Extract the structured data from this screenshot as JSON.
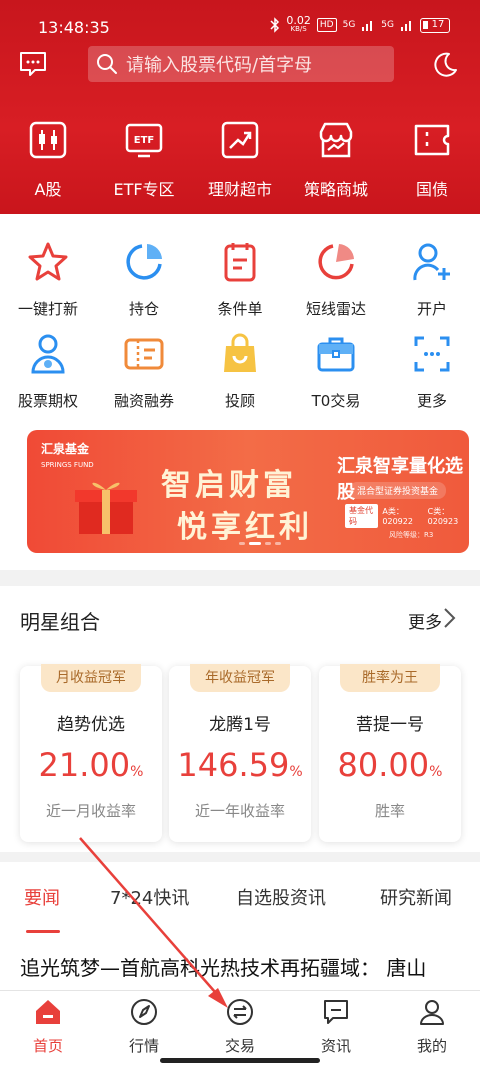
{
  "status_bar": {
    "time": "13:48:35",
    "net_speed": "0.02",
    "net_unit": "KB/S",
    "hd": "HD",
    "signal1": "5G",
    "signal2": "5G",
    "battery": "17"
  },
  "header": {
    "search_placeholder": "请输入股票代码/首字母"
  },
  "top_nav": [
    {
      "label": "A股",
      "icon": "candlestick-icon"
    },
    {
      "label": "ETF专区",
      "icon": "etf-icon"
    },
    {
      "label": "理财超市",
      "icon": "trend-chart-icon"
    },
    {
      "label": "策略商城",
      "icon": "store-icon"
    },
    {
      "label": "国债",
      "icon": "ticket-icon"
    }
  ],
  "grid": [
    {
      "label": "一键打新",
      "icon": "star-icon"
    },
    {
      "label": "持仓",
      "icon": "pie-chart-icon"
    },
    {
      "label": "条件单",
      "icon": "document-icon"
    },
    {
      "label": "短线雷达",
      "icon": "radar-icon"
    },
    {
      "label": "开户",
      "icon": "add-user-icon"
    },
    {
      "label": "股票期权",
      "icon": "person-coin-icon"
    },
    {
      "label": "融资融券",
      "icon": "voucher-icon"
    },
    {
      "label": "投顾",
      "icon": "shopping-bag-icon"
    },
    {
      "label": "T0交易",
      "icon": "briefcase-icon"
    },
    {
      "label": "更多",
      "icon": "scan-more-icon"
    }
  ],
  "banner": {
    "brand": "汇泉基金",
    "brand_en": "SPRINGS FUND",
    "slogan1": "智启财富",
    "slogan2": "悦享红利",
    "title": "汇泉智享量化选股",
    "subtitle": "混合型证券投资基金",
    "code_label": "基金代码",
    "code_a": "A类：020922",
    "code_c": "C类：020923",
    "risk": "风险等级：R3"
  },
  "star": {
    "title": "明星组合",
    "more": "更多",
    "cards": [
      {
        "badge": "月收益冠军",
        "name": "趋势优选",
        "value": "21.00",
        "unit": "%",
        "desc": "近一月收益率"
      },
      {
        "badge": "年收益冠军",
        "name": "龙腾1号",
        "value": "146.59",
        "unit": "%",
        "desc": "近一年收益率"
      },
      {
        "badge": "胜率为王",
        "name": "菩提一号",
        "value": "80.00",
        "unit": "%",
        "desc": "胜率"
      }
    ]
  },
  "news": {
    "tabs": [
      "要闻",
      "7*24快讯",
      "自选股资讯",
      "研究新闻"
    ],
    "headline": "追光筑梦—首航高科光热技术再拓疆域： 唐山"
  },
  "bottom_nav": [
    {
      "label": "首页"
    },
    {
      "label": "行情"
    },
    {
      "label": "交易"
    },
    {
      "label": "资讯"
    },
    {
      "label": "我的"
    }
  ],
  "colors": {
    "brand_red": "#d81e24",
    "accent_red": "#e8403b",
    "badge_bg": "#fbe6c8",
    "icon_blue": "#2b8ff0"
  }
}
